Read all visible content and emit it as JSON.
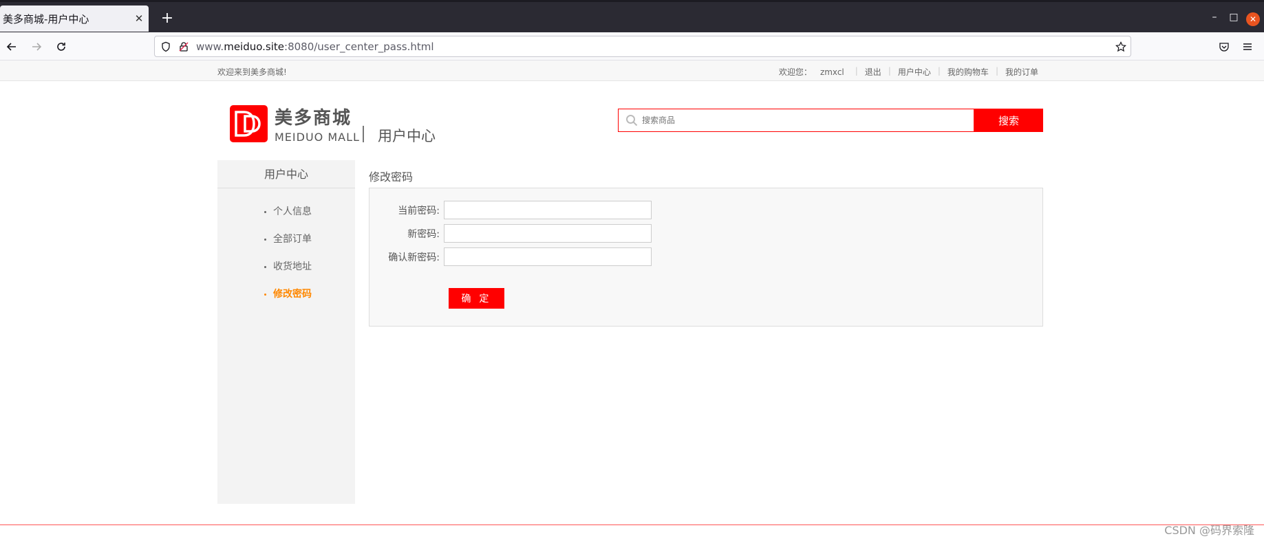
{
  "browser": {
    "tab_title": "美多商城-用户中心",
    "tab_close": "✕",
    "new_tab": "+",
    "url_prefix": "www.",
    "url_host": "meiduo.site",
    "url_rest": ":8080/user_center_pass.html",
    "minimize": "–",
    "maximize": "□",
    "close": "✕"
  },
  "topbar": {
    "welcome": "欢迎来到美多商城!",
    "greeting": "欢迎您：",
    "username": "zmxcl",
    "links": [
      "退出",
      "用户中心",
      "我的购物车",
      "我的订单"
    ]
  },
  "header": {
    "logo_cn": "美多商城",
    "logo_en": "MEIDUO MALL",
    "page_subtitle": "用户中心",
    "search_placeholder": "搜索商品",
    "search_button": "搜索"
  },
  "sidebar": {
    "title": "用户中心",
    "items": [
      {
        "label": "个人信息",
        "active": false
      },
      {
        "label": "全部订单",
        "active": false
      },
      {
        "label": "收货地址",
        "active": false
      },
      {
        "label": "修改密码",
        "active": true
      }
    ]
  },
  "main": {
    "title": "修改密码",
    "fields": {
      "current": {
        "label": "当前密码:",
        "value": ""
      },
      "new": {
        "label": "新密码:",
        "value": ""
      },
      "confirm": {
        "label": "确认新密码:",
        "value": ""
      }
    },
    "submit": "确 定"
  },
  "watermark": "CSDN @码界索隆",
  "colors": {
    "brand": "#ff0000",
    "active": "#ff8800"
  }
}
